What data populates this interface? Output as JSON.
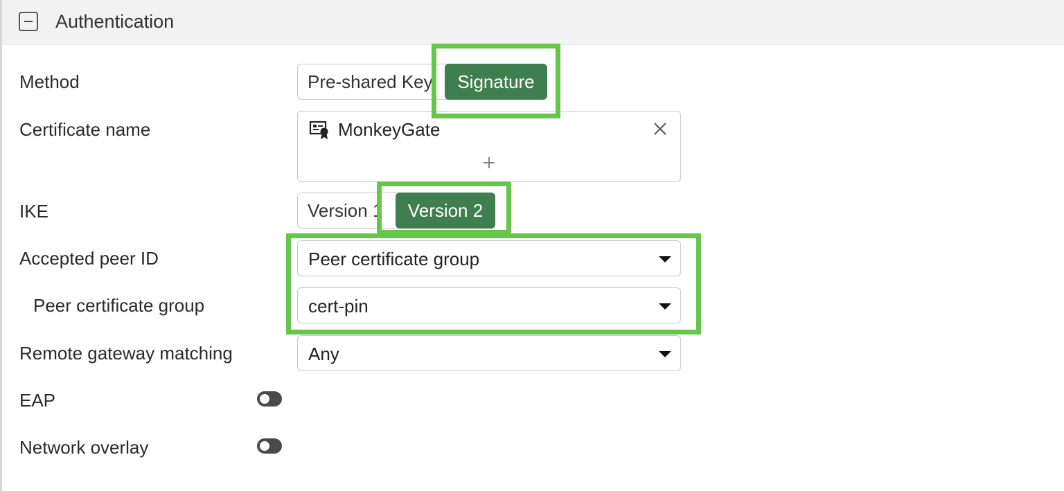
{
  "section": {
    "title": "Authentication",
    "collapse_icon": "minus-square-icon"
  },
  "fields": {
    "method": {
      "label": "Method",
      "options": [
        "Pre-shared Key",
        "Signature"
      ],
      "selected": "Signature"
    },
    "certificate": {
      "label": "Certificate name",
      "value": "MonkeyGate",
      "item_icon": "certificate-icon",
      "remove_icon": "close-icon",
      "add_icon": "plus-icon"
    },
    "ike": {
      "label": "IKE",
      "options": [
        "Version 1",
        "Version 2"
      ],
      "selected": "Version 2"
    },
    "accepted_peer_id": {
      "label": "Accepted peer ID",
      "value": "Peer certificate group"
    },
    "peer_cert_group": {
      "label": "Peer certificate group",
      "value": "cert-pin"
    },
    "remote_gateway_matching": {
      "label": "Remote gateway matching",
      "value": "Any"
    },
    "eap": {
      "label": "EAP",
      "enabled": false
    },
    "network_overlay": {
      "label": "Network overlay",
      "enabled": false
    }
  },
  "colors": {
    "active_segment": "#3f7f4f",
    "highlight_box": "#65c64a",
    "header_bg": "#f2f2f2",
    "toggle_off": "#4a4a4a"
  }
}
